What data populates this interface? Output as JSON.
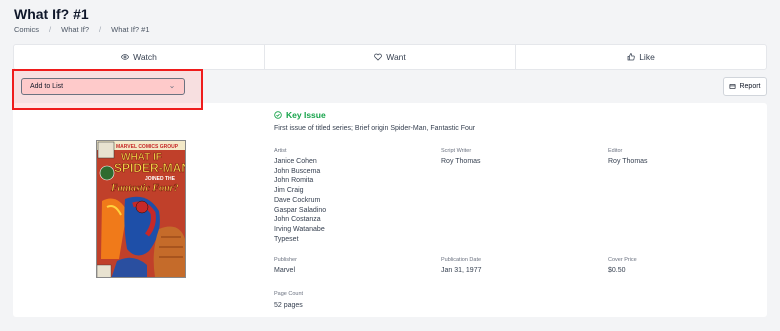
{
  "page": {
    "title": "What If? #1",
    "breadcrumb": [
      "Comics",
      "What If?",
      "What If? #1"
    ]
  },
  "actions": {
    "watch": "Watch",
    "want": "Want",
    "like": "Like"
  },
  "add_to_list": {
    "label": "Add to List"
  },
  "report": {
    "label": "Report"
  },
  "cover": {
    "publisher_logo": "MARVEL COMICS GROUP",
    "title_line1": "WHAT IF",
    "title_line2": "SPIDER-MAN",
    "title_line3": "JOINED THE",
    "title_line4": "Fantastic Four?"
  },
  "issue": {
    "key_issue_label": "Key Issue",
    "key_issue_description": "First issue of titled series; Brief origin Spider-Man, Fantastic Four",
    "artist_label": "Artist",
    "artists": [
      "Janice Cohen",
      "John Buscema",
      "John Romita",
      "Jim Craig",
      "Dave Cockrum",
      "Gaspar Saladino",
      "John Costanza",
      "Irving Watanabe",
      "Typeset"
    ],
    "script_writer_label": "Script Writer",
    "script_writer": "Roy Thomas",
    "editor_label": "Editor",
    "editor": "Roy Thomas",
    "publisher_label": "Publisher",
    "publisher": "Marvel",
    "publication_date_label": "Publication Date",
    "publication_date": "Jan 31, 1977",
    "cover_price_label": "Cover Price",
    "cover_price": "$0.50",
    "page_count_label": "Page Count",
    "page_count": "52 pages"
  },
  "colors": {
    "key_issue": "#16a34a",
    "highlight": "#ef1c1c"
  }
}
